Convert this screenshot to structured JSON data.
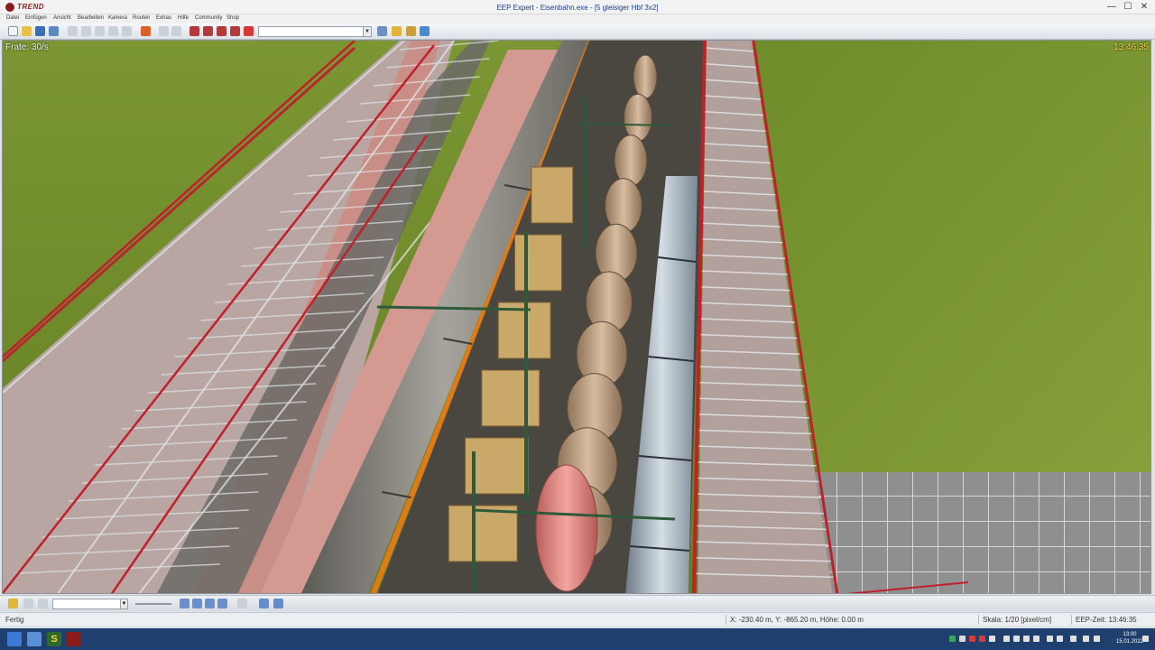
{
  "window": {
    "logo_text": "TREND",
    "title": "EEP Expert - Eisenbahn.exe - [5 gleisiger Hbf 3x2]",
    "minimize": "—",
    "maximize": "☐",
    "close": "✕"
  },
  "menu": [
    "Datei",
    "Einfügen",
    "Ansicht",
    "Bearbeiten",
    "Kamera",
    "Routen",
    "Extras",
    "Hilfe",
    "Community",
    "Shop"
  ],
  "toolbar": {
    "icons": [
      "new-file-icon",
      "open-folder-icon",
      "save-icon",
      "save-as-icon",
      "copy-icon",
      "paste-icon",
      "print-icon",
      "cut-icon",
      "undo-icon",
      "redo-icon",
      "layout-icon",
      "train-icon",
      "wagon-icon",
      "signal-icon",
      "crane-icon",
      "track-icon"
    ],
    "combo_value": ""
  },
  "viewport": {
    "frame_rate": "Frate: 30/s",
    "clock": "13:46:35"
  },
  "bottom_toolbar": {
    "input_value": "",
    "controls": [
      "pause-icon",
      "play-icon",
      "step-icon",
      "fast-forward-icon",
      "record-icon",
      "zoom-in-icon",
      "zoom-out-icon"
    ]
  },
  "status": {
    "ready": "Fertig",
    "coords": "X: -230.40 m, Y: -865.20 m, Höhe: 0.00 m",
    "scale": "Skala: 1/20 [pixel/cm]",
    "eep_time": "EEP-Zeit: 13:46:35"
  },
  "taskbar": {
    "time": "13:00",
    "date": "15.01.2022",
    "s_app": "S"
  },
  "colors": {
    "grass": "#6e8a2c",
    "platform": "#c98f86",
    "roof_frame": "#c0202a",
    "tank_wagon": "#c9a98a",
    "pink_tank": "#e8908c",
    "silver_coach": "#b7c3cc",
    "taskbar": "#1f3f6e"
  }
}
